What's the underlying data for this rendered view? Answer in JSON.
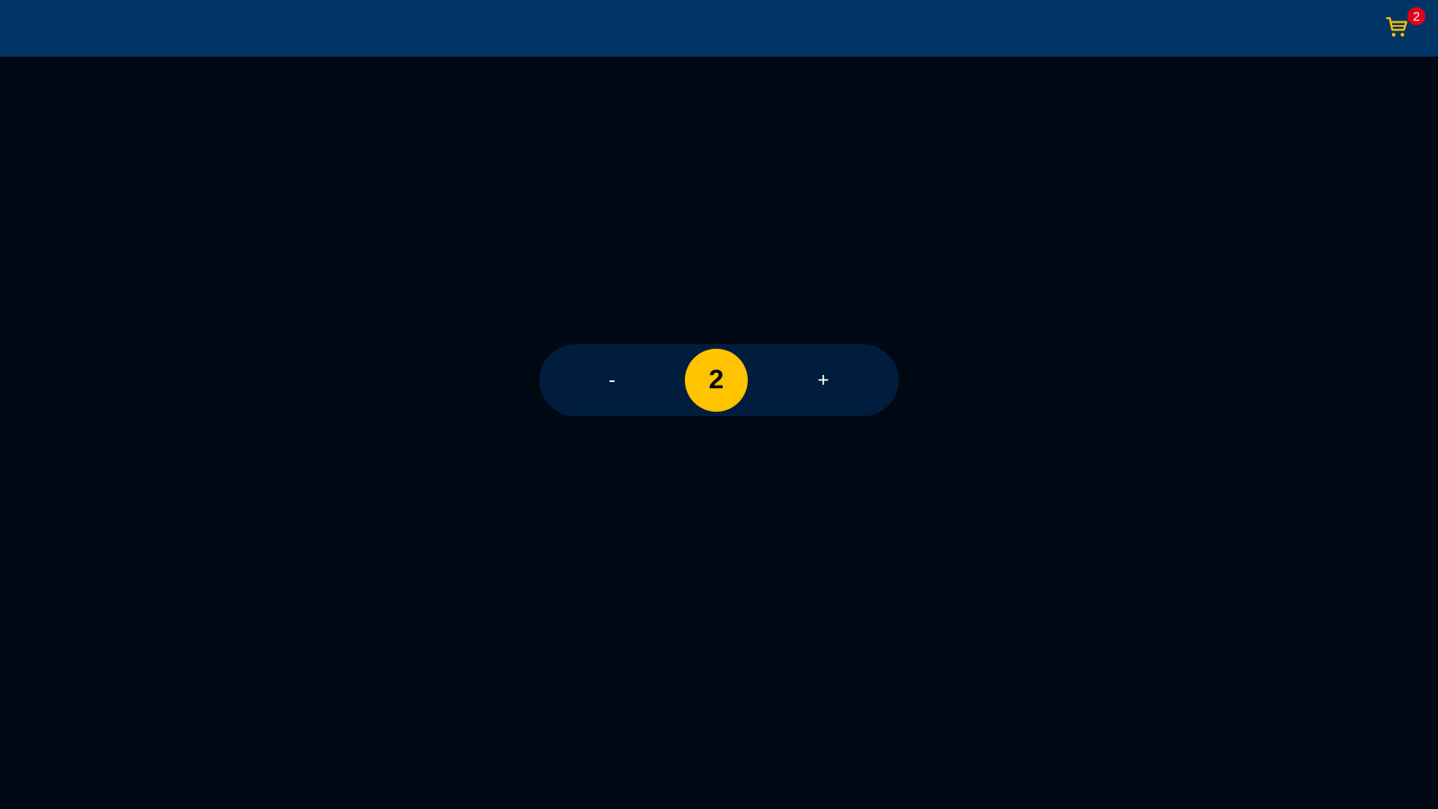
{
  "header": {
    "cart": {
      "icon": "shopping-cart-icon",
      "badge_count": "2",
      "icon_color": "#ffc300",
      "badge_color": "#e5001c"
    },
    "background_color": "#003566"
  },
  "stepper": {
    "decrement_label": "-",
    "quantity": "2",
    "increment_label": "+",
    "accent_color": "#ffc300",
    "track_color": "#001d3d"
  },
  "page": {
    "background_color": "#000814"
  }
}
